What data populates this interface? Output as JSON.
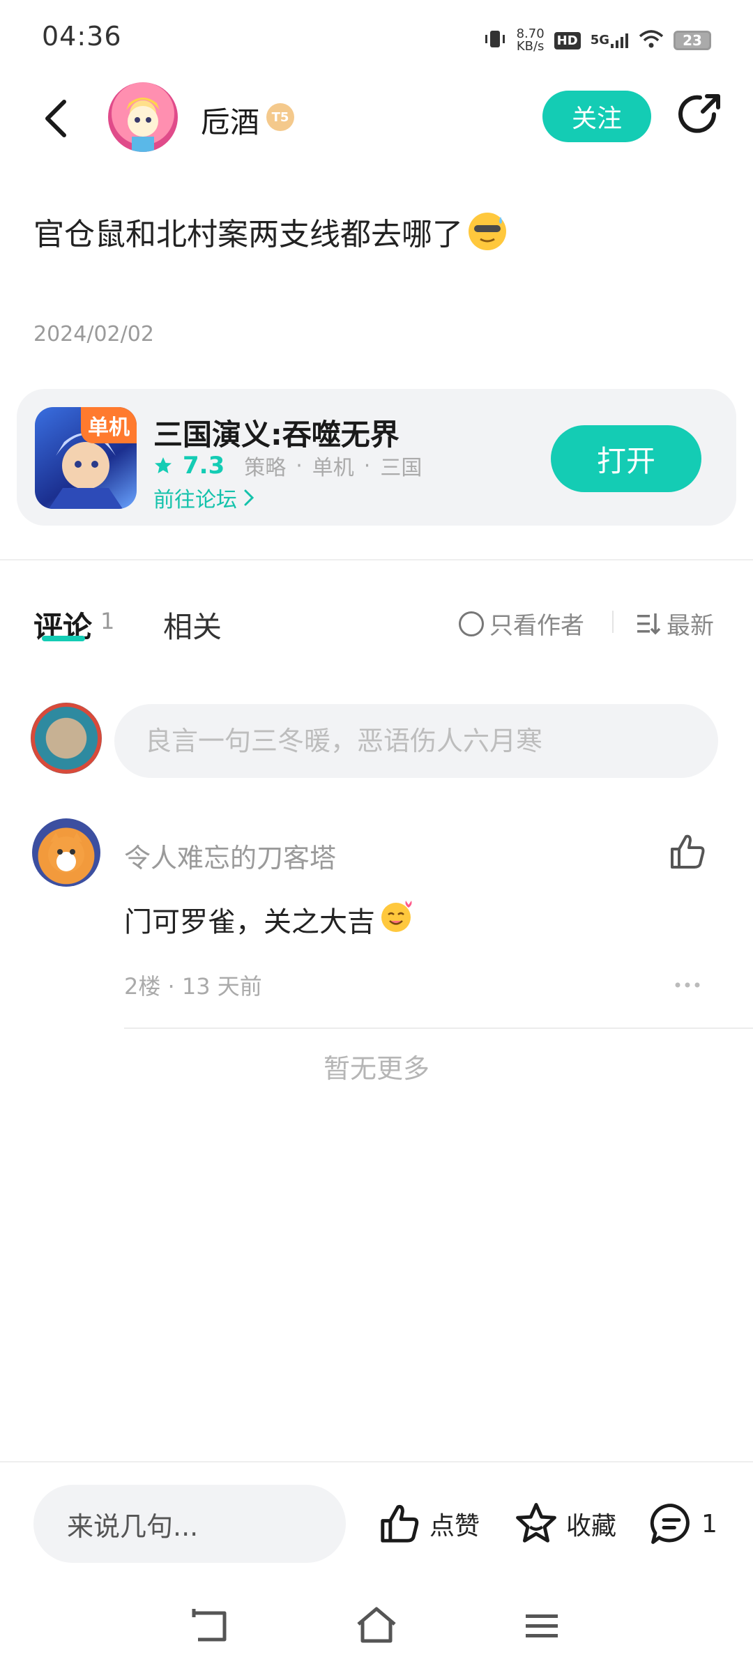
{
  "status_bar": {
    "time": "04:36",
    "net_speed_value": "8.70",
    "net_speed_unit": "KB/s",
    "hd": "HD",
    "signal": "5G",
    "battery": "23"
  },
  "header": {
    "username": "卮酒",
    "level": "T5",
    "follow_label": "关注"
  },
  "post": {
    "text": "官仓鼠和北村案两支线都去哪了",
    "date": "2024/02/02"
  },
  "game_card": {
    "icon_tag": "单机",
    "title": "三国演义:吞噬无界",
    "score": "7.3",
    "tags": [
      "策略",
      "单机",
      "三国"
    ],
    "forum_link": "前往论坛",
    "open_label": "打开"
  },
  "tabs": {
    "comment_label": "评论",
    "comment_count": "1",
    "related_label": "相关",
    "author_only_label": "只看作者",
    "sort_label": "最新"
  },
  "comment_box": {
    "placeholder": "良言一句三冬暖，恶语伤人六月寒"
  },
  "comments": [
    {
      "author": "令人难忘的刀客塔",
      "text": "门可罗雀，关之大吉",
      "meta": "2楼 · 13 天前"
    }
  ],
  "no_more": "暂无更多",
  "bottom_bar": {
    "input_placeholder": "来说几句...",
    "like_label": "点赞",
    "favorite_label": "收藏",
    "comment_count": "1"
  },
  "colors": {
    "accent": "#14ccb4",
    "card_bg": "#f2f3f5"
  }
}
